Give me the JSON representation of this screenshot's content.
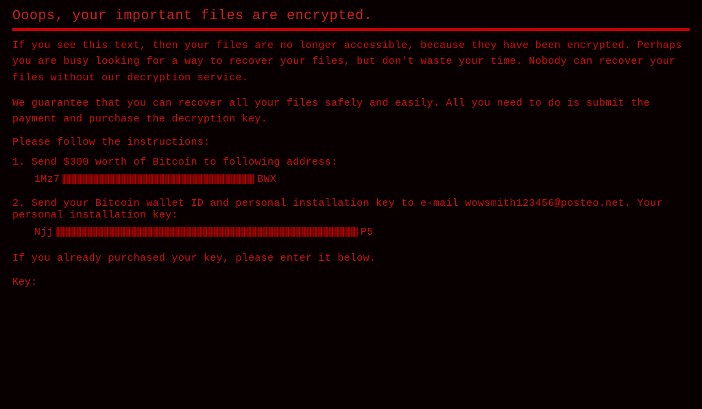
{
  "title": "Ooops, your important files are encrypted.",
  "red_bar": true,
  "paragraph1": "If you see this text, then your files are no longer accessible, because they have been encrypted.  Perhaps you are busy looking for a way to recover your files, but don't waste your time.  Nobody can recover your files without our decryption service.",
  "paragraph2": "We guarantee that you can recover all your files safely and easily.  All you need to do is submit the payment and purchase the decryption key.",
  "instruction_header": "Please follow the instructions:",
  "step1_label": "1. Send $300 worth of Bitcoin to following address:",
  "bitcoin_address_prefix": "1Mz7",
  "bitcoin_address_suffix": "BWX",
  "step2_label": "2. Send your Bitcoin wallet ID and personal installation key to e-mail wowsmith123456@posteo.net. Your personal installation key:",
  "key_prefix": "Njj",
  "key_suffix": "P5",
  "footer_line": "If you already purchased your key, please enter it below.",
  "key_prompt": "Key:"
}
